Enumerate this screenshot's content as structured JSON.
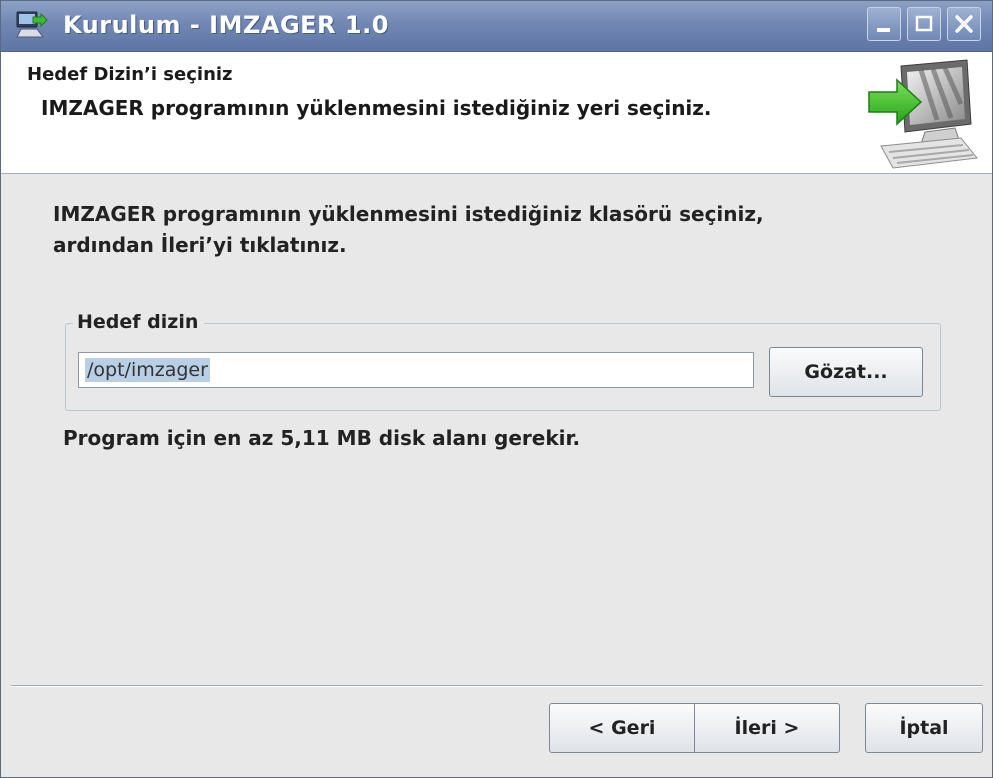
{
  "window": {
    "title": "Kurulum - IMZAGER 1.0",
    "icons": [
      "installer-app-icon",
      "minimize-icon",
      "maximize-icon",
      "close-icon"
    ]
  },
  "header": {
    "title": "Hedef Dizin’i seçiniz",
    "subtitle": "IMZAGER programının yüklenmesini istediğiniz yeri seçiniz.",
    "graphic_icon": "computer-install-arrow-icon"
  },
  "instructions": {
    "line1": "IMZAGER programının yüklenmesini istediğiniz klasörü seçiniz,",
    "line2": "ardından İleri’yi tıklatınız."
  },
  "target": {
    "legend": "Hedef dizin",
    "path_value": "/opt/imzager",
    "browse_label": "Gözat..."
  },
  "disk_note": "Program için en az 5,11 MB disk alanı gerekir.",
  "buttons": {
    "back": "< Geri",
    "next": "İleri >",
    "cancel": "İptal"
  },
  "colors": {
    "titlebar": "#7187b3",
    "dialog_bg": "#e8e8e8",
    "header_bg": "#ffffff",
    "selection": "#b8cfe5"
  }
}
